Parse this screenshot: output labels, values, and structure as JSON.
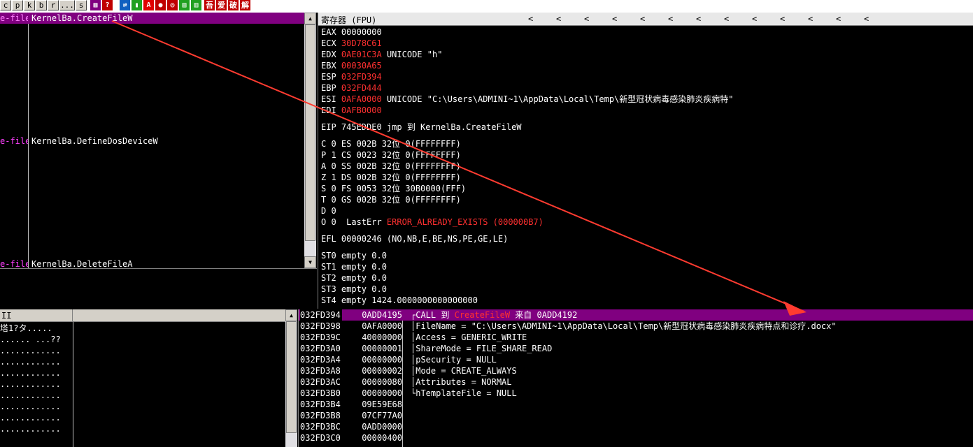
{
  "toolbar": {
    "letter_buttons": [
      "c",
      "p",
      "k",
      "b",
      "r",
      "...",
      "s"
    ],
    "icons": [
      {
        "name": "grid-icon",
        "glyph": "▦",
        "color": "#800080"
      },
      {
        "name": "help-icon",
        "glyph": "?",
        "color": "#c00000"
      },
      {
        "name": "save-icon",
        "glyph": "⇄",
        "color": "#1060c0"
      },
      {
        "name": "bar-icon",
        "glyph": "▮",
        "color": "#20a020"
      },
      {
        "name": "a-icon",
        "glyph": "A",
        "color": "#e00000"
      },
      {
        "name": "record-icon",
        "glyph": "●",
        "color": "#c00000"
      },
      {
        "name": "target-icon",
        "glyph": "◎",
        "color": "#c00000"
      },
      {
        "name": "list-icon",
        "glyph": "▤",
        "color": "#20a020"
      },
      {
        "name": "grid2-icon",
        "glyph": "▥",
        "color": "#20a020"
      }
    ],
    "chinese_buttons": [
      "吾",
      "爱",
      "破",
      "解"
    ]
  },
  "disasm": {
    "rows": [
      {
        "addr": "e-file",
        "text": "KernelBa.CreateFileW",
        "selected": true
      },
      {
        "addr": "e-file",
        "text": "KernelBa.DefineDosDeviceW",
        "selected": false
      },
      {
        "addr": "e-file",
        "text": "KernelBa.DeleteFileA",
        "selected": false
      }
    ]
  },
  "registers": {
    "title": "寄存器 (FPU)",
    "arrows": [
      "<",
      "<",
      "<",
      "<",
      "<",
      "<",
      "<",
      "<",
      "<",
      "<",
      "<",
      "<",
      "<"
    ],
    "gp": [
      {
        "name": "EAX",
        "value": "00000000",
        "red": false,
        "comment": ""
      },
      {
        "name": "ECX",
        "value": "30D78C61",
        "red": true,
        "comment": ""
      },
      {
        "name": "EDX",
        "value": "0AE01C3A",
        "red": true,
        "comment": "UNICODE \"h\""
      },
      {
        "name": "EBX",
        "value": "00030A65",
        "red": true,
        "comment": ""
      },
      {
        "name": "ESP",
        "value": "032FD394",
        "red": true,
        "comment": ""
      },
      {
        "name": "EBP",
        "value": "032FD444",
        "red": true,
        "comment": ""
      },
      {
        "name": "ESI",
        "value": "0AFA0000",
        "red": true,
        "comment": "UNICODE \"C:\\Users\\ADMINI~1\\AppData\\Local\\Temp\\新型冠状病毒感染肺炎疾病特\""
      },
      {
        "name": "EDI",
        "value": "0AFB0000",
        "red": true,
        "comment": ""
      }
    ],
    "eip": "EIP 745EDDE0 jmp 到 KernelBa.CreateFileW",
    "flags": [
      "C 0  ES 002B 32位 0(FFFFFFFF)",
      "P 1  CS 0023 32位 0(FFFFFFFF)",
      "A 0  SS 002B 32位 0(FFFFFFFF)",
      "Z 1  DS 002B 32位 0(FFFFFFFF)",
      "S 0  FS 0053 32位 30B0000(FFF)",
      "T 0  GS 002B 32位 0(FFFFFFFF)",
      "D 0"
    ],
    "lasterr_prefix": "O 0  LastErr ",
    "lasterr_value": "ERROR_ALREADY_EXISTS (000000B7)",
    "efl": "EFL 00000246 (NO,NB,E,BE,NS,PE,GE,LE)",
    "fpu": [
      "ST0 empty 0.0",
      "ST1 empty 0.0",
      "ST2 empty 0.0",
      "ST3 empty 0.0",
      "ST4 empty 1424.0000000000000000"
    ]
  },
  "dump": {
    "header": "II",
    "rows": [
      "塔1?タ.....",
      "...... ...??",
      "............",
      "............",
      "............",
      "............",
      "............",
      "............",
      "............",
      "............"
    ]
  },
  "stack": {
    "rows": [
      {
        "addr": "032FD394",
        "value": "0ADD4195",
        "comment": "",
        "selected": true
      },
      {
        "addr": "032FD398",
        "value": "0AFA0000",
        "comment": "FileName = \"C:\\Users\\ADMINI~1\\AppData\\Local\\Temp\\新型冠状病毒感染肺炎疾病特点和诊疗.docx\"",
        "selected": false
      },
      {
        "addr": "032FD39C",
        "value": "40000000",
        "comment": "Access = GENERIC_WRITE",
        "selected": false
      },
      {
        "addr": "032FD3A0",
        "value": "00000001",
        "comment": "ShareMode = FILE_SHARE_READ",
        "selected": false
      },
      {
        "addr": "032FD3A4",
        "value": "00000000",
        "comment": "pSecurity = NULL",
        "selected": false
      },
      {
        "addr": "032FD3A8",
        "value": "00000002",
        "comment": "Mode = CREATE_ALWAYS",
        "selected": false
      },
      {
        "addr": "032FD3AC",
        "value": "00000080",
        "comment": "Attributes = NORMAL",
        "selected": false
      },
      {
        "addr": "032FD3B0",
        "value": "00000000",
        "comment": "hTemplateFile = NULL",
        "selected": false
      },
      {
        "addr": "032FD3B4",
        "value": "09E59E68",
        "comment": "",
        "selected": false
      },
      {
        "addr": "032FD3B8",
        "value": "07CF77A0",
        "comment": "",
        "selected": false
      },
      {
        "addr": "032FD3BC",
        "value": "0ADD0000",
        "comment": "",
        "selected": false
      },
      {
        "addr": "032FD3C0",
        "value": "00000400",
        "comment": "",
        "selected": false
      }
    ],
    "call_prefix": "CALL 到 ",
    "call_target": "CreateFileW",
    "call_suffix": " 来自 0ADD4192"
  },
  "colors": {
    "selection": "#800080",
    "register_changed": "#ff3030",
    "annotation_arrow": "#ff3b30"
  }
}
